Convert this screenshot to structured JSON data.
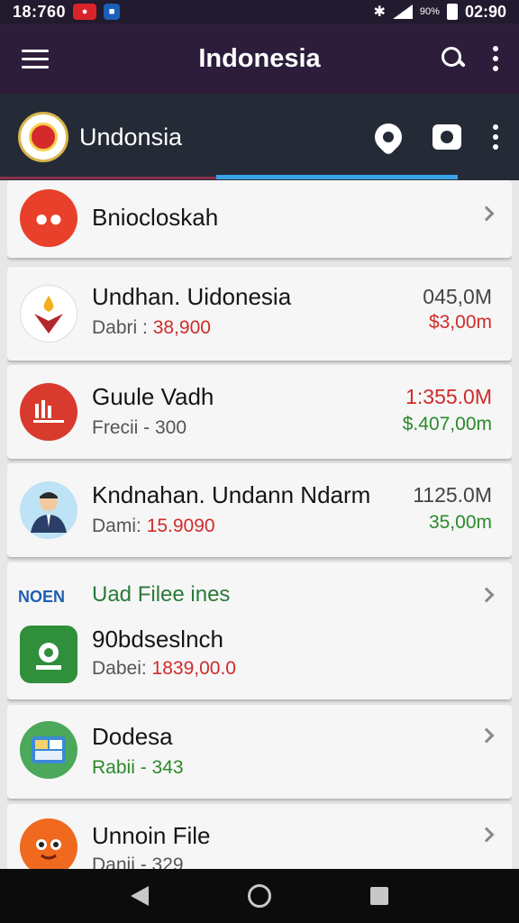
{
  "status_bar": {
    "time": "18:760",
    "clock": "02:90",
    "extra": "90%"
  },
  "app_bar": {
    "title": "Indonesia"
  },
  "sub_bar": {
    "title": "Undonsia"
  },
  "colors": {
    "app_bar": "#2d1d3b",
    "sub_bar": "#242a36",
    "accent_tab": "#3aa3e8",
    "negative": "#d02b2b",
    "positive": "#2a8a2a"
  },
  "list": {
    "items": [
      {
        "title": "Bniocloskah",
        "icon": "fox-face-icon"
      },
      {
        "title": "Undhan. Uidonesia",
        "subtitle_label": "Dabri :",
        "subtitle_value": "38,900",
        "amount": "045,0M",
        "amount_sub": "$3,00m",
        "icon": "torch-logo-icon"
      },
      {
        "title": "Guule Vadh",
        "subtitle_label": "Frecii - 300",
        "subtitle_value": "",
        "amount": "1:355.0M",
        "amount_sub": "$.407,00m",
        "icon": "chart-logo-icon"
      },
      {
        "title": "Kndnahan. Undann Ndarm",
        "subtitle_label": "Dami:",
        "subtitle_value": "15.9090",
        "amount": "1125.0M",
        "amount_sub": "35,00m",
        "icon": "person-avatar-icon"
      },
      {
        "header": "Uad Filee ines",
        "header_brand": "NOEN",
        "title": "90bdseslnch",
        "subtitle_label": "Dabei:",
        "subtitle_value": "1839,00.0",
        "icon": "robot-logo-icon"
      },
      {
        "title": "Dodesa",
        "subtitle_label": "Rabii - 343",
        "icon": "tablet-app-icon"
      },
      {
        "title": "Unnoin File",
        "subtitle_label": "Danii - 329",
        "icon": "cartoon-face-icon"
      }
    ]
  }
}
